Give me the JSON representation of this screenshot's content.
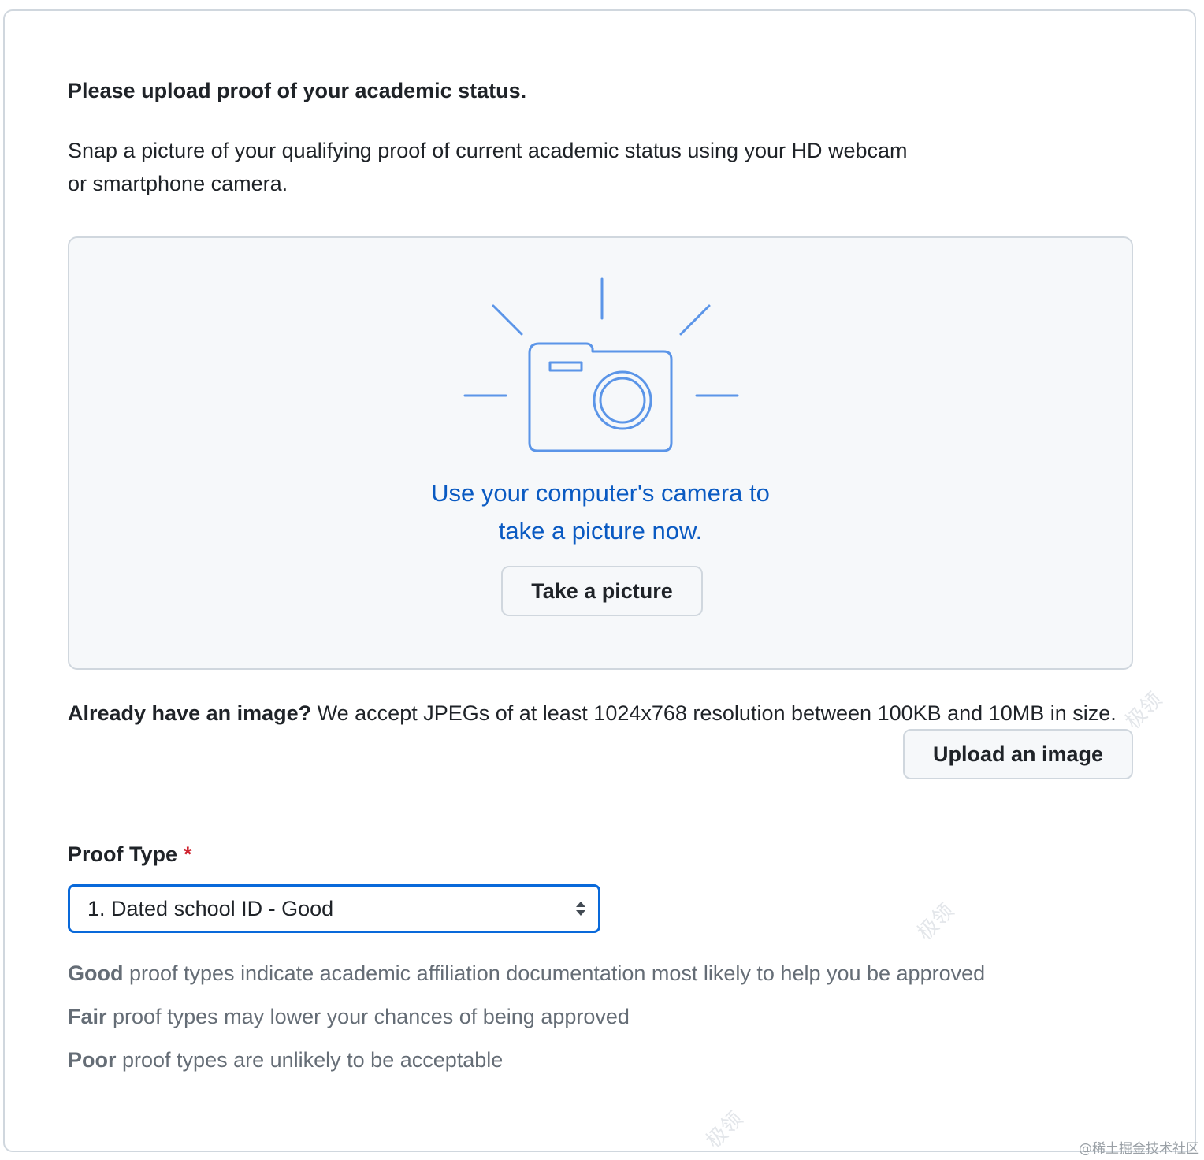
{
  "header": {
    "title": "Please upload proof of your academic status."
  },
  "intro": {
    "text": "Snap a picture of your qualifying proof of current academic status using your HD webcam or smartphone camera."
  },
  "camera_panel": {
    "icon": "camera-icon",
    "caption_line1": "Use your computer's camera to",
    "caption_line2": "take a picture now.",
    "button_label": "Take a picture",
    "accent_color": "#0a5ac2",
    "icon_color": "#5b95e8"
  },
  "upload": {
    "prompt_bold": "Already have an image?",
    "prompt_text": " We accept JPEGs of at least 1024x768 resolution between 100KB and 10MB in size.",
    "button_label": "Upload an image"
  },
  "proof_type": {
    "label": "Proof Type",
    "required_marker": "*",
    "selected": "1. Dated school ID - Good",
    "focus_color": "#0969da"
  },
  "hints": [
    {
      "bold": "Good",
      "text": " proof types indicate academic affiliation documentation most likely to help you be approved"
    },
    {
      "bold": "Fair",
      "text": " proof types may lower your chances of being approved"
    },
    {
      "bold": "Poor",
      "text": " proof types are unlikely to be acceptable"
    }
  ],
  "watermarks": {
    "mark": "极领",
    "credit": "@稀土掘金技术社区"
  }
}
